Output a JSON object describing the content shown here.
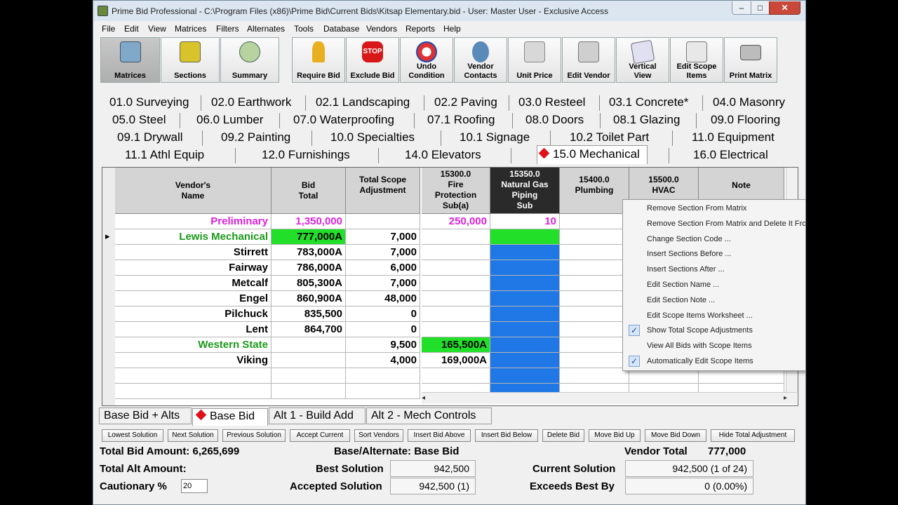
{
  "window": {
    "title": "Prime Bid Professional - C:\\Program Files (x86)\\Prime Bid\\Current Bids\\Kitsap Elementary.bid - User: Master User - Exclusive Access",
    "min": "–",
    "max": "□",
    "close": "✕"
  },
  "menu": [
    "File",
    "Edit",
    "View",
    "Matrices",
    "Filters",
    "Alternates",
    "Tools",
    "Database",
    "Vendors",
    "Reports",
    "Help"
  ],
  "toolbar": [
    {
      "label": "Matrices",
      "icon": "folders-icon",
      "active": true
    },
    {
      "label": "Sections",
      "icon": "book-icon"
    },
    {
      "label": "Summary",
      "icon": "money-bag-icon"
    },
    {
      "label": "Require Bid",
      "icon": "gold-key-icon"
    },
    {
      "label": "Exclude Bid",
      "icon": "stop-sign-icon"
    },
    {
      "label1": "Undo",
      "label2": "Condition",
      "icon": "undo-arrow-icon"
    },
    {
      "label1": "Vendor",
      "label2": "Contacts",
      "icon": "contacts-icon"
    },
    {
      "label": "Unit Price",
      "icon": "unit-price-icon"
    },
    {
      "label": "Edit Vendor",
      "icon": "vendor-truck-icon"
    },
    {
      "label1": "Vertical",
      "label2": "View",
      "icon": "vertical-view-icon"
    },
    {
      "label1": "Edit Scope",
      "label2": "Items",
      "icon": "scope-items-icon"
    },
    {
      "label": "Print Matrix",
      "icon": "printer-icon"
    }
  ],
  "sections": [
    [
      "01.0 Surveying",
      "02.0 Earthwork",
      "02.1 Landscaping",
      "02.2 Paving",
      "03.0 Resteel",
      "03.1 Concrete*",
      "04.0 Masonry"
    ],
    [
      "05.0 Steel",
      "06.0 Lumber",
      "07.0 Waterproofing",
      "07.1 Roofing",
      "08.0 Doors",
      "08.1 Glazing",
      "09.0 Flooring"
    ],
    [
      "09.1 Drywall",
      "09.2 Painting",
      "10.0  Specialties",
      "10.1 Signage",
      "10.2 Toilet Part",
      "11.0 Equipment"
    ],
    [
      "11.1 Athl Equip",
      "12.0 Furnishings",
      "14.0 Elevators",
      "15.0 Mechanical",
      "16.0 Electrical"
    ]
  ],
  "grid": {
    "headers": {
      "vendor": [
        "Vendor's",
        "Name"
      ],
      "bid_total": [
        "Bid",
        "Total"
      ],
      "scope_adj": [
        "Total Scope",
        "Adjustment"
      ],
      "s15300": [
        "15300.0",
        "Fire",
        "Protection",
        "Sub(a)"
      ],
      "s15350": [
        "15350.0",
        "Natural Gas",
        "Piping",
        "Sub"
      ],
      "s15400": [
        "15400.0",
        "Plumbing"
      ],
      "s15500": [
        "15500.0",
        "HVAC"
      ],
      "note": [
        "Note"
      ]
    },
    "rows": [
      {
        "name": "Preliminary",
        "bid": "1,350,000",
        "adj": "",
        "s15300": "250,000",
        "s15350": "10",
        "color": "#e020e0"
      },
      {
        "name": "Lewis Mechanical",
        "bid": "777,000A",
        "adj": "7,000",
        "s15300": "",
        "s15350": "",
        "color": "#1a9a1a",
        "selected": true
      },
      {
        "name": "Stirrett",
        "bid": "783,000A",
        "adj": "7,000",
        "s15300": "",
        "s15350": ""
      },
      {
        "name": "Fairway",
        "bid": "786,000A",
        "adj": "6,000",
        "s15300": "",
        "s15350": ""
      },
      {
        "name": "Metcalf",
        "bid": "805,300A",
        "adj": "7,000",
        "s15300": "",
        "s15350": ""
      },
      {
        "name": "Engel",
        "bid": "860,900A",
        "adj": "48,000",
        "s15300": "",
        "s15350": ""
      },
      {
        "name": "Pilchuck",
        "bid": "835,500",
        "adj": "0",
        "s15300": "",
        "s15350": ""
      },
      {
        "name": "Lent",
        "bid": "864,700",
        "adj": "0",
        "s15300": "",
        "s15350": ""
      },
      {
        "name": "Western State",
        "bid": "",
        "adj": "9,500",
        "s15300": "165,500A",
        "s15350": "",
        "color": "#1a9a1a"
      },
      {
        "name": "Viking",
        "bid": "",
        "adj": "4,000",
        "s15300": "169,000A",
        "s15350": ""
      }
    ],
    "row_pointer": "▸"
  },
  "context_menu": [
    {
      "label": "Remove Section From Matrix"
    },
    {
      "label": "Remove Section From Matrix and Delete It From Bid"
    },
    {
      "label": "Change Section Code ..."
    },
    {
      "label": "Insert Sections Before ..."
    },
    {
      "label": "Insert Sections After ..."
    },
    {
      "label": "Edit Section Name ..."
    },
    {
      "label": "Edit Section Note ..."
    },
    {
      "label": "Edit Scope Items Worksheet ..."
    },
    {
      "label": "Show Total Scope Adjustments",
      "checked": true
    },
    {
      "label": "View All Bids with Scope Items"
    },
    {
      "label": "Automatically Edit Scope Items",
      "checked": true
    }
  ],
  "bottom_tabs": [
    "Base Bid + Alts",
    "Base Bid",
    "Alt 1 - Build Add",
    "Alt 2 - Mech Controls"
  ],
  "actions": [
    "Lowest Solution",
    "Next Solution",
    "Previous Solution",
    "Accept Current",
    "Sort Vendors",
    "Insert Bid Above",
    "Insert Bid Below",
    "Delete Bid",
    "Move Bid Up",
    "Move Bid Down",
    "Hide Total Adjustment"
  ],
  "status": {
    "total_bid_amount": "Total Bid Amount: 6,265,699",
    "base_alternate": "Base/Alternate: Base Bid",
    "vendor_total_label": "Vendor Total",
    "vendor_total": "777,000",
    "total_alt_amount": "Total Alt Amount:",
    "best_solution_label": "Best Solution",
    "best_solution": "942,500",
    "current_solution_label": "Current Solution",
    "current_solution": "942,500 (1 of 24)",
    "cautionary_label": "Cautionary %",
    "cautionary_value": "20",
    "accepted_solution_label": "Accepted Solution",
    "accepted_solution": "942,500 (1)",
    "exceeds_best_label": "Exceeds Best By",
    "exceeds_best": "0 (0.00%)"
  },
  "colors": {
    "accent_green": "#22e02a",
    "selected_blue": "#1f78e6",
    "header_dark": "#2a2a2a",
    "diamond_red": "#e0101a"
  }
}
